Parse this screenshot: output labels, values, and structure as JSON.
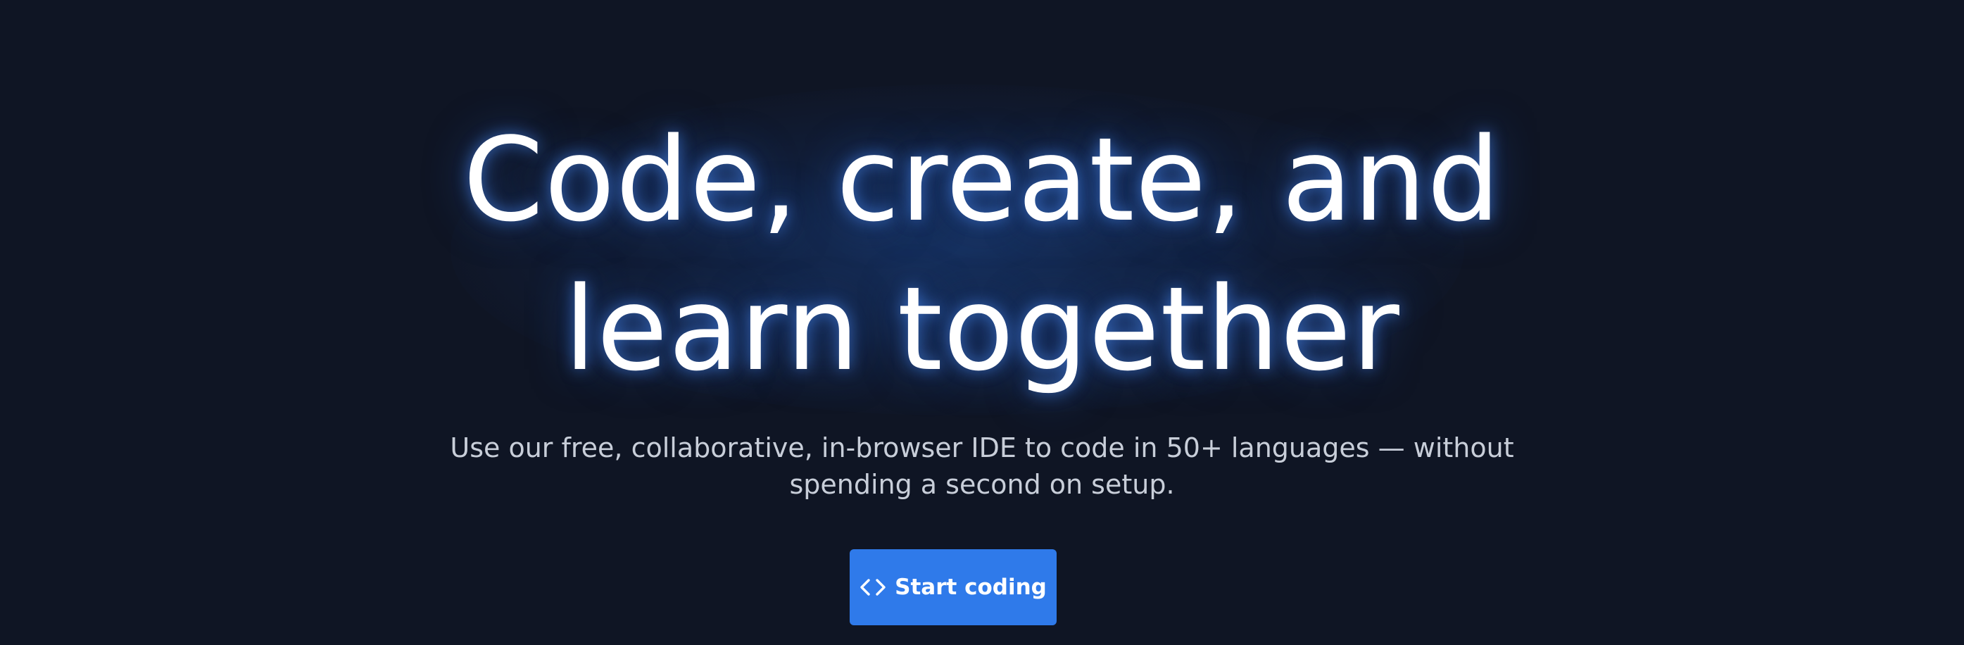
{
  "hero": {
    "title_line1": "Code, create, and",
    "title_line2": "learn together",
    "subtitle": "Use our free, collaborative, in-browser IDE to code in 50+ languages — without spending a second on setup.",
    "cta": {
      "label": "Start coding",
      "icon": "code-brackets-icon"
    }
  },
  "colors": {
    "background": "#0f1524",
    "glow": "#1a3f7e",
    "title": "#ffffff",
    "subtitle": "#c8ced9",
    "cta_background": "#2f7aea"
  }
}
